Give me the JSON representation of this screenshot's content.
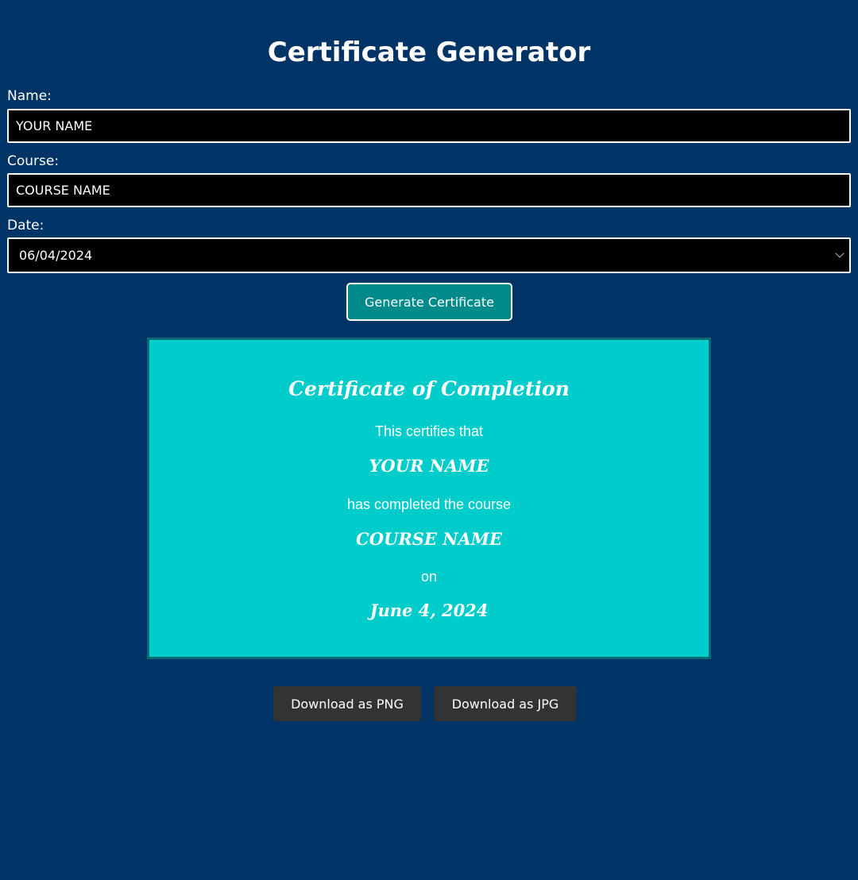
{
  "page": {
    "title": "Certificate Generator"
  },
  "form": {
    "name_label": "Name:",
    "name_value": "YOUR NAME",
    "course_label": "Course:",
    "course_value": "COURSE NAME",
    "date_label": "Date:",
    "date_value": "06/04/2024",
    "generate_label": "Generate Certificate"
  },
  "certificate": {
    "heading": "Certificate of Completion",
    "certifies_text": "This certifies that",
    "name": "YOUR NAME",
    "completed_text": "has completed the course",
    "course": "COURSE NAME",
    "on_text": "on",
    "date": "June 4, 2024"
  },
  "downloads": {
    "png_label": "Download as PNG",
    "jpg_label": "Download as JPG"
  },
  "colors": {
    "background": "#003366",
    "certificate_bg": "#00cccc",
    "generate_button": "#008b8b",
    "download_button": "#333333"
  },
  "icons": {
    "date_dropdown": "chevron-down-icon"
  }
}
